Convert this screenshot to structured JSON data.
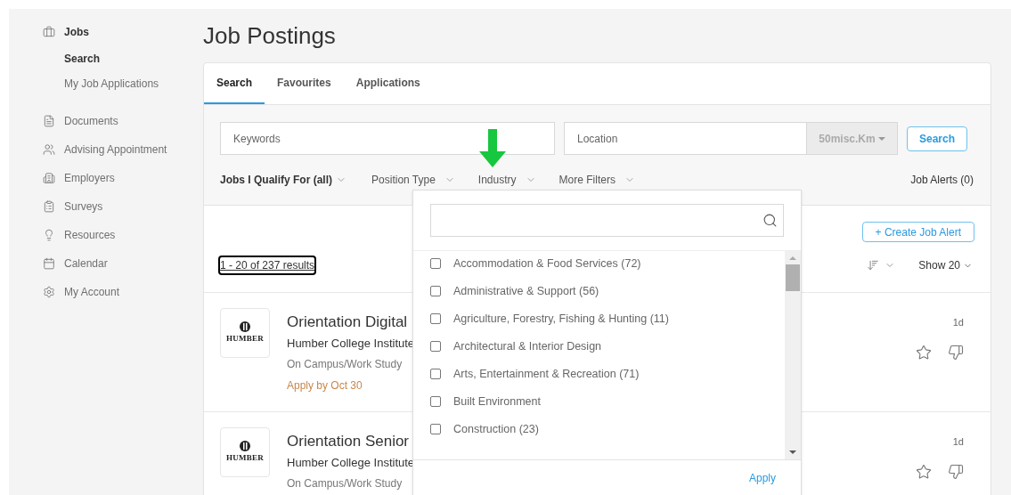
{
  "sidebar": {
    "items": [
      {
        "label": "Jobs",
        "selected": true,
        "children": [
          {
            "label": "Search",
            "selected": true
          },
          {
            "label": "My Job Applications",
            "selected": false
          }
        ]
      },
      {
        "label": "Documents",
        "selected": false
      },
      {
        "label": "Advising Appointment",
        "selected": false
      },
      {
        "label": "Employers",
        "selected": false
      },
      {
        "label": "Surveys",
        "selected": false
      },
      {
        "label": "Resources",
        "selected": false
      },
      {
        "label": "Calendar",
        "selected": false
      },
      {
        "label": "My Account",
        "selected": false
      }
    ]
  },
  "page_title": "Job Postings",
  "tabs": [
    {
      "label": "Search",
      "selected": true
    },
    {
      "label": "Favourites",
      "selected": false
    },
    {
      "label": "Applications",
      "selected": false
    }
  ],
  "search": {
    "keywords_placeholder": "Keywords",
    "location_placeholder": "Location",
    "distance": "50misc.Km",
    "button": "Search"
  },
  "filters": [
    {
      "label": "Jobs I Qualify For (all)",
      "active": true
    },
    {
      "label": "Position Type",
      "active": false
    },
    {
      "label": "Industry",
      "active": false
    },
    {
      "label": "More Filters",
      "active": false
    }
  ],
  "job_alerts": "Job Alerts (0)",
  "create_alert": "+ Create Job Alert",
  "results": {
    "text": "1 - 20 of 237 results",
    "focused": true
  },
  "show": "Show 20",
  "jobs": [
    {
      "logo": "HUMBER",
      "title": "Orientation Digital",
      "company": "Humber College Institute",
      "type": "On Campus/Work Study",
      "deadline": "Apply by Oct 30",
      "age": "1d"
    },
    {
      "logo": "HUMBER",
      "title": "Orientation Senior",
      "company": "Humber College Institute",
      "type": "On Campus/Work Study",
      "age": "1d"
    }
  ],
  "industry_dropdown": {
    "options": [
      {
        "label": "Accommodation & Food Services (72)",
        "checked": false
      },
      {
        "label": "Administrative & Support (56)",
        "checked": false
      },
      {
        "label": "Agriculture, Forestry, Fishing & Hunting (11)",
        "checked": false
      },
      {
        "label": "Architectural & Interior Design",
        "checked": false
      },
      {
        "label": "Arts, Entertainment & Recreation (71)",
        "checked": false
      },
      {
        "label": "Built Environment",
        "checked": false
      },
      {
        "label": "Construction (23)",
        "checked": false
      }
    ],
    "apply": "Apply"
  }
}
